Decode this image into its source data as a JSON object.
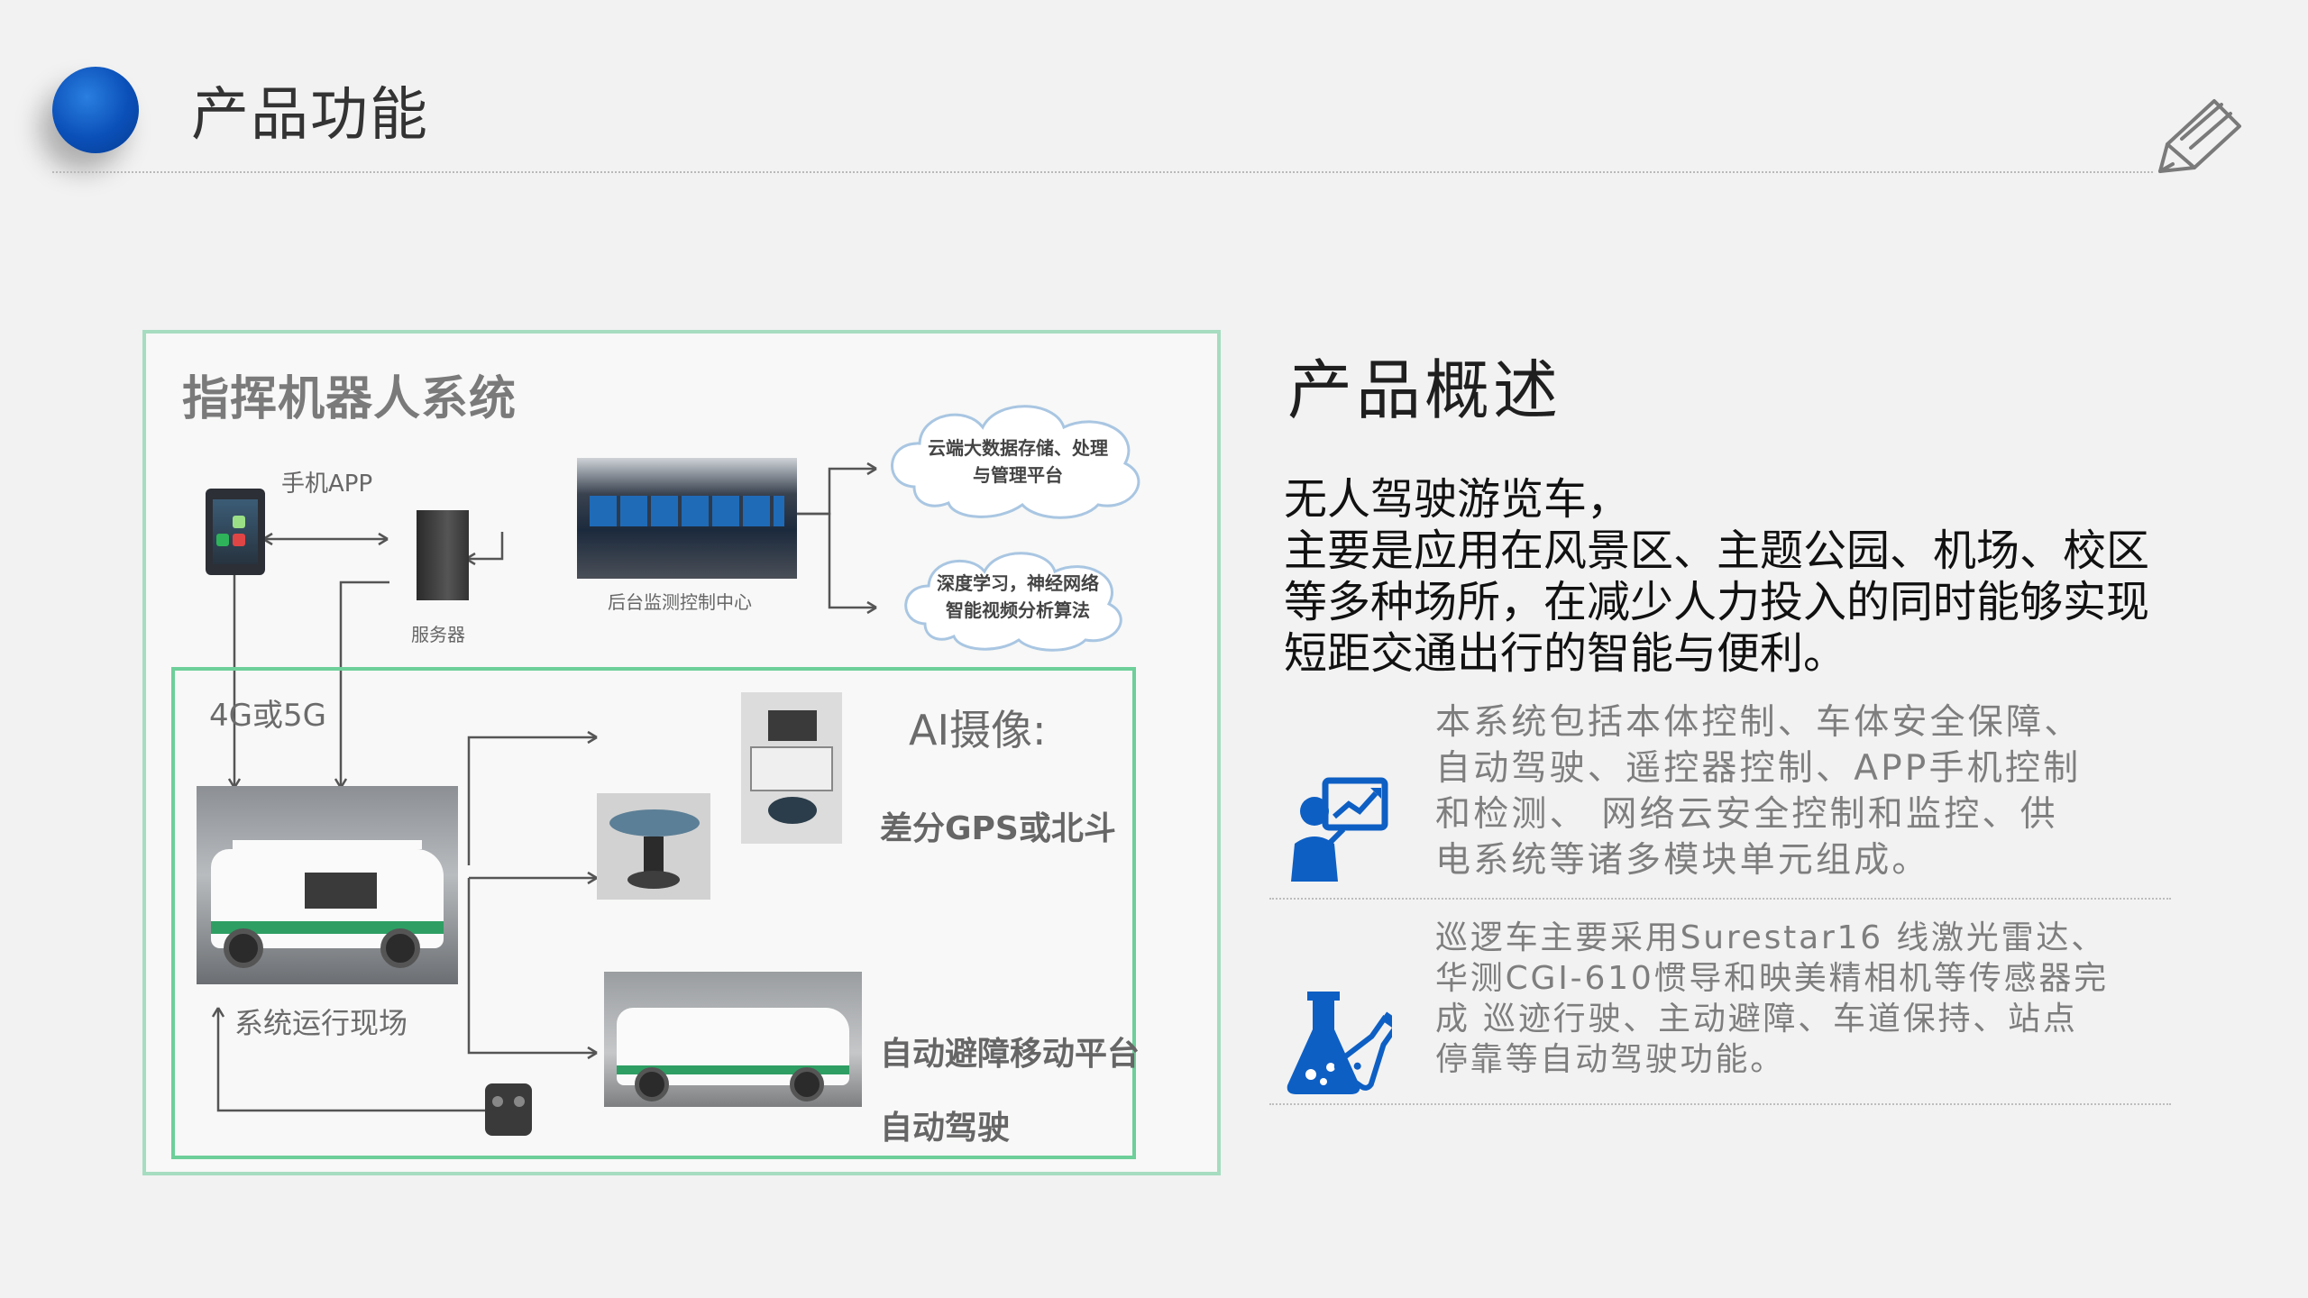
{
  "header": {
    "title": "产品功能",
    "accent_color": "#0a4fb8",
    "decor_icon": "pen-icon"
  },
  "diagram": {
    "title": "指挥机器人系统",
    "phone_label": "手机APP",
    "server_label": "服务器",
    "monitor_label": "后台监测控制中心",
    "cloud1_line1": "云端大数据存储、处理",
    "cloud1_line2": "与管理平台",
    "cloud2_line1": "深度学习，神经网络",
    "cloud2_line2": "智能视频分析算法",
    "network_label": "4G或5G",
    "ai_camera_label": "AI摄像:",
    "gps_label": "差分GPS或北斗",
    "site_label": "系统运行现场",
    "platform_label": "自动避障移动平台",
    "autopilot_label": "自动驾驶",
    "frame_color": "#6dcf99"
  },
  "overview": {
    "title": "产品概述",
    "summary": [
      "无人驾驶游览车，",
      "主要是应用在风景区、主题公园、机场、校区",
      "等多种场所，在减少人力投入的同时能够实现",
      "短距交通出行的智能与便利。"
    ],
    "features": [
      {
        "icon": "presenter-chart-icon",
        "lines": [
          "本系统包括本体控制、车体安全保障、",
          "自动驾驶、遥控器控制、APP手机控制",
          "和检测、 网络云安全控制和监控、供",
          "电系统等诸多模块单元组成。"
        ]
      },
      {
        "icon": "lab-flask-icon",
        "lines": [
          "巡逻车主要采用Surestar16 线激光雷达、",
          "华测CGI-610惯导和映美精相机等传感器完",
          "成 巡迹行驶、主动避障、车道保持、站点",
          "停靠等自动驾驶功能。"
        ]
      }
    ],
    "icon_color": "#0d5fc4"
  }
}
